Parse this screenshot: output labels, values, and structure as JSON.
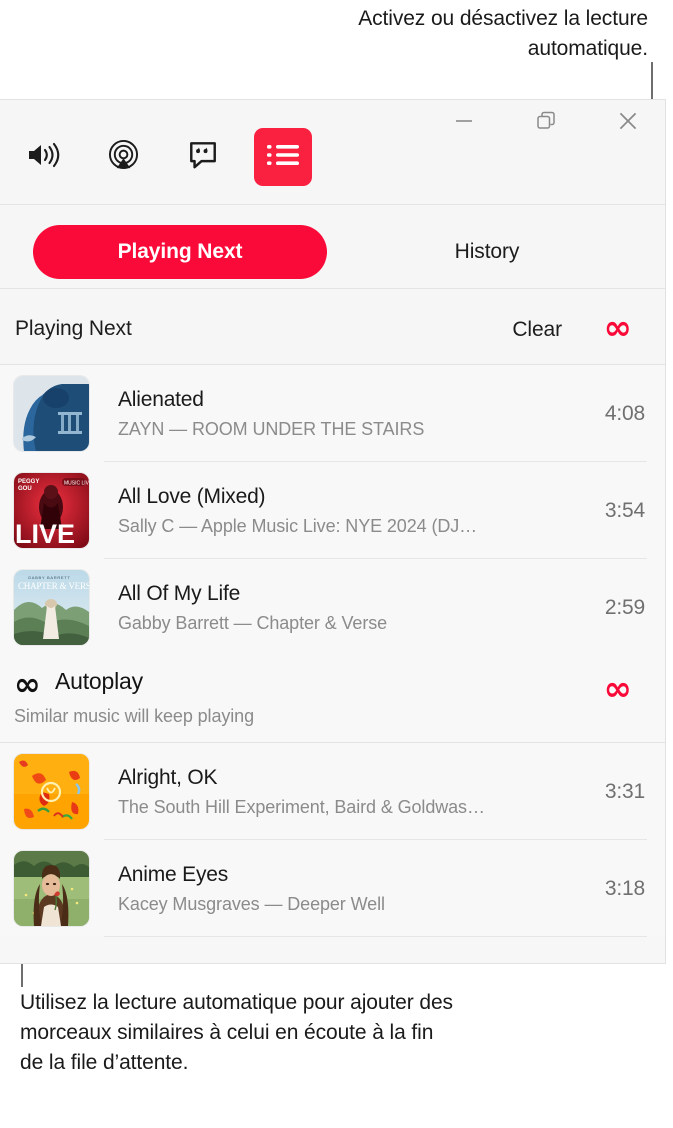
{
  "callouts": {
    "top": "Activez ou désactivez la lecture automatique.",
    "bottom": "Utilisez la lecture automatique pour ajouter des morceaux similaires à celui en écoute à la fin de la file d’attente."
  },
  "window": {
    "toolbar": {
      "icons": [
        {
          "name": "volume-icon",
          "label": "Volume"
        },
        {
          "name": "airplay-icon",
          "label": "AirPlay"
        },
        {
          "name": "lyrics-icon",
          "label": "Lyrics"
        },
        {
          "name": "queue-icon",
          "label": "Playing Next",
          "active": true
        }
      ],
      "window_controls": [
        {
          "name": "minimize-button",
          "label": "Minimize"
        },
        {
          "name": "restore-button",
          "label": "Restore"
        },
        {
          "name": "close-button",
          "label": "Close"
        }
      ]
    },
    "tabs": [
      {
        "label": "Playing Next",
        "active": true
      },
      {
        "label": "History",
        "active": false
      }
    ],
    "section_header": {
      "title": "Playing Next",
      "clear_label": "Clear",
      "infinity_glyph": "∞"
    },
    "queue_tracks": [
      {
        "title": "Alienated",
        "subtitle": "ZAYN — ROOM UNDER THE STAIRS",
        "duration": "4:08",
        "artwork": "alienated-artwork"
      },
      {
        "title": "All Love (Mixed)",
        "subtitle": "Sally C — Apple Music Live: NYE 2024 (DJ…",
        "duration": "3:54",
        "artwork": "all-love-artwork"
      },
      {
        "title": "All Of My Life",
        "subtitle": "Gabby Barrett — Chapter & Verse",
        "duration": "2:59",
        "artwork": "all-of-my-life-artwork"
      }
    ],
    "autoplay": {
      "infinity_glyph": "∞",
      "title": "Autoplay",
      "subtitle": "Similar music will keep playing",
      "toggle_glyph": "∞"
    },
    "autoplay_tracks": [
      {
        "title": "Alright, OK",
        "subtitle": "The South Hill Experiment, Baird & Goldwas…",
        "duration": "3:31",
        "artwork": "alright-ok-artwork"
      },
      {
        "title": "Anime Eyes",
        "subtitle": "Kacey Musgraves — Deeper Well",
        "duration": "3:18",
        "artwork": "anime-eyes-artwork"
      }
    ]
  },
  "colors": {
    "accent_red": "#fa0a38",
    "toolbar_active_red": "#fa2040",
    "window_bg": "#f7f7f7",
    "text_primary": "#1a1a1a",
    "text_secondary": "#8b8b8b"
  }
}
